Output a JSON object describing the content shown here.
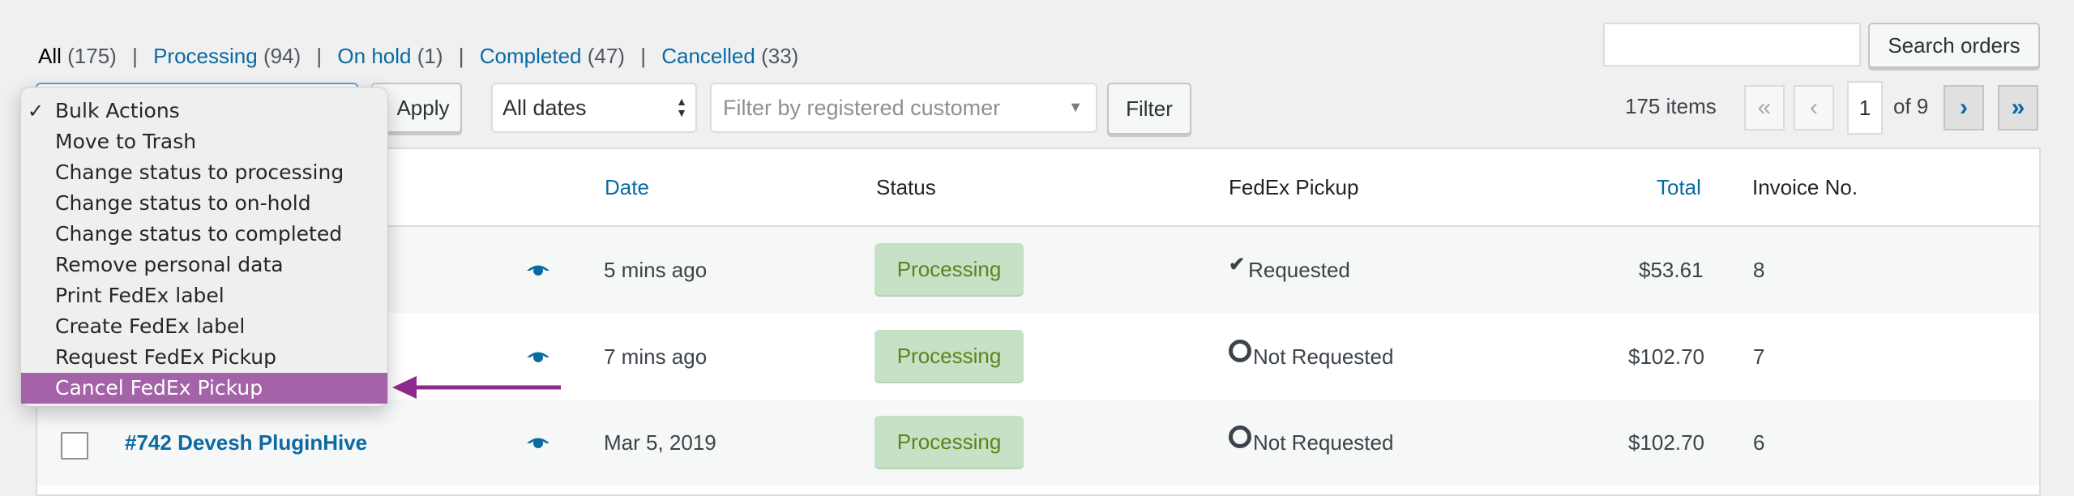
{
  "status_links": [
    {
      "label": "All",
      "count": "(175)",
      "current": true
    },
    {
      "label": "Processing",
      "count": "(94)",
      "current": false
    },
    {
      "label": "On hold",
      "count": "(1)",
      "current": false
    },
    {
      "label": "Completed",
      "count": "(47)",
      "current": false
    },
    {
      "label": "Cancelled",
      "count": "(33)",
      "current": false
    }
  ],
  "toolbar": {
    "apply_label": "Apply",
    "dates_value": "All dates",
    "customer_placeholder": "Filter by registered customer",
    "filter_label": "Filter",
    "search_value": "",
    "search_button": "Search orders"
  },
  "pagination": {
    "items": "175 items",
    "first": "«",
    "prev": "‹",
    "current_page": "1",
    "of": "of 9",
    "next": "›",
    "last": "»"
  },
  "bulk_menu": {
    "selected": "Bulk Actions",
    "options": [
      "Bulk Actions",
      "Move to Trash",
      "Change status to processing",
      "Change status to on-hold",
      "Change status to completed",
      "Remove personal data",
      "Print FedEx label",
      "Create FedEx label",
      "Request FedEx Pickup",
      "Cancel FedEx Pickup"
    ],
    "highlighted": "Cancel FedEx Pickup",
    "highlight_color": "#a463a8",
    "arrow_color": "#8e2a8e"
  },
  "table": {
    "headers": {
      "date": "Date",
      "status": "Status",
      "fedex": "FedEx Pickup",
      "total": "Total",
      "invoice": "Invoice No."
    },
    "rows": [
      {
        "order": "",
        "date": "5 mins ago",
        "status": "Processing",
        "fedex": "Requested",
        "fedex_icon": "check-icon",
        "total": "$53.61",
        "invoice": "8"
      },
      {
        "order": "",
        "date": "7 mins ago",
        "status": "Processing",
        "fedex": "Not Requested",
        "fedex_icon": "circle-icon",
        "total": "$102.70",
        "invoice": "7"
      },
      {
        "order": "#742 Devesh PluginHive",
        "date": "Mar 5, 2019",
        "status": "Processing",
        "fedex": "Not Requested",
        "fedex_icon": "circle-icon",
        "total": "$102.70",
        "invoice": "6"
      }
    ]
  },
  "colors": {
    "link": "#0a6aa1",
    "badge_bg": "#c6e1c6",
    "badge_text": "#5b841b"
  }
}
